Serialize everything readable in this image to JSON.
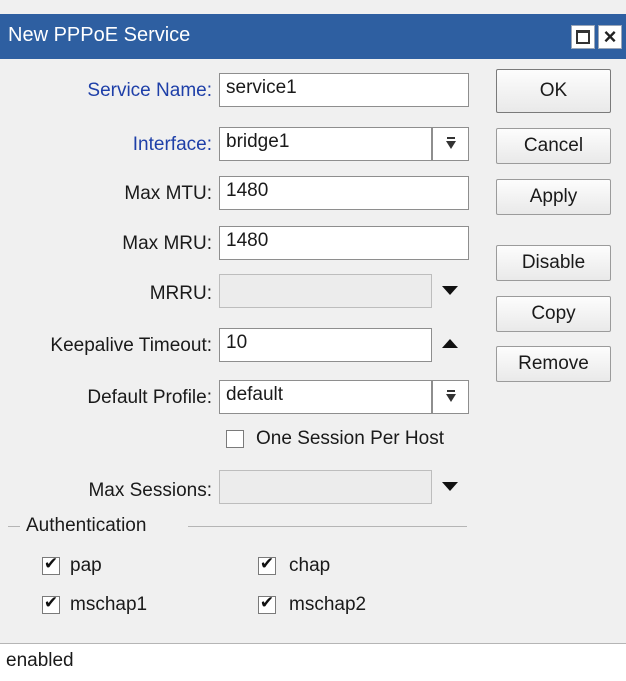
{
  "window": {
    "title": "New PPPoE Service"
  },
  "form": {
    "service_name": {
      "label": "Service Name:",
      "value": "service1"
    },
    "interface": {
      "label": "Interface:",
      "value": "bridge1"
    },
    "max_mtu": {
      "label": "Max MTU:",
      "value": "1480"
    },
    "max_mru": {
      "label": "Max MRU:",
      "value": "1480"
    },
    "mrru": {
      "label": "MRRU:",
      "value": ""
    },
    "keepalive_timeout": {
      "label": "Keepalive Timeout:",
      "value": "10"
    },
    "default_profile": {
      "label": "Default Profile:",
      "value": "default"
    },
    "one_session_per_host": {
      "label": "One Session Per Host",
      "checked": false
    },
    "max_sessions": {
      "label": "Max Sessions:",
      "value": ""
    }
  },
  "authentication": {
    "group_label": "Authentication",
    "options": [
      {
        "label": "pap",
        "checked": true
      },
      {
        "label": "chap",
        "checked": true
      },
      {
        "label": "mschap1",
        "checked": true
      },
      {
        "label": "mschap2",
        "checked": true
      }
    ]
  },
  "buttons": {
    "ok": "OK",
    "cancel": "Cancel",
    "apply": "Apply",
    "disable": "Disable",
    "copy": "Copy",
    "remove": "Remove"
  },
  "status": {
    "text": "enabled"
  },
  "icons": {
    "checkmark": "check-icon",
    "maximize": "maximize-icon",
    "close": "close-icon"
  },
  "colors": {
    "titlebar": "#2e5fa1",
    "label_accent": "#1e3fa8"
  }
}
